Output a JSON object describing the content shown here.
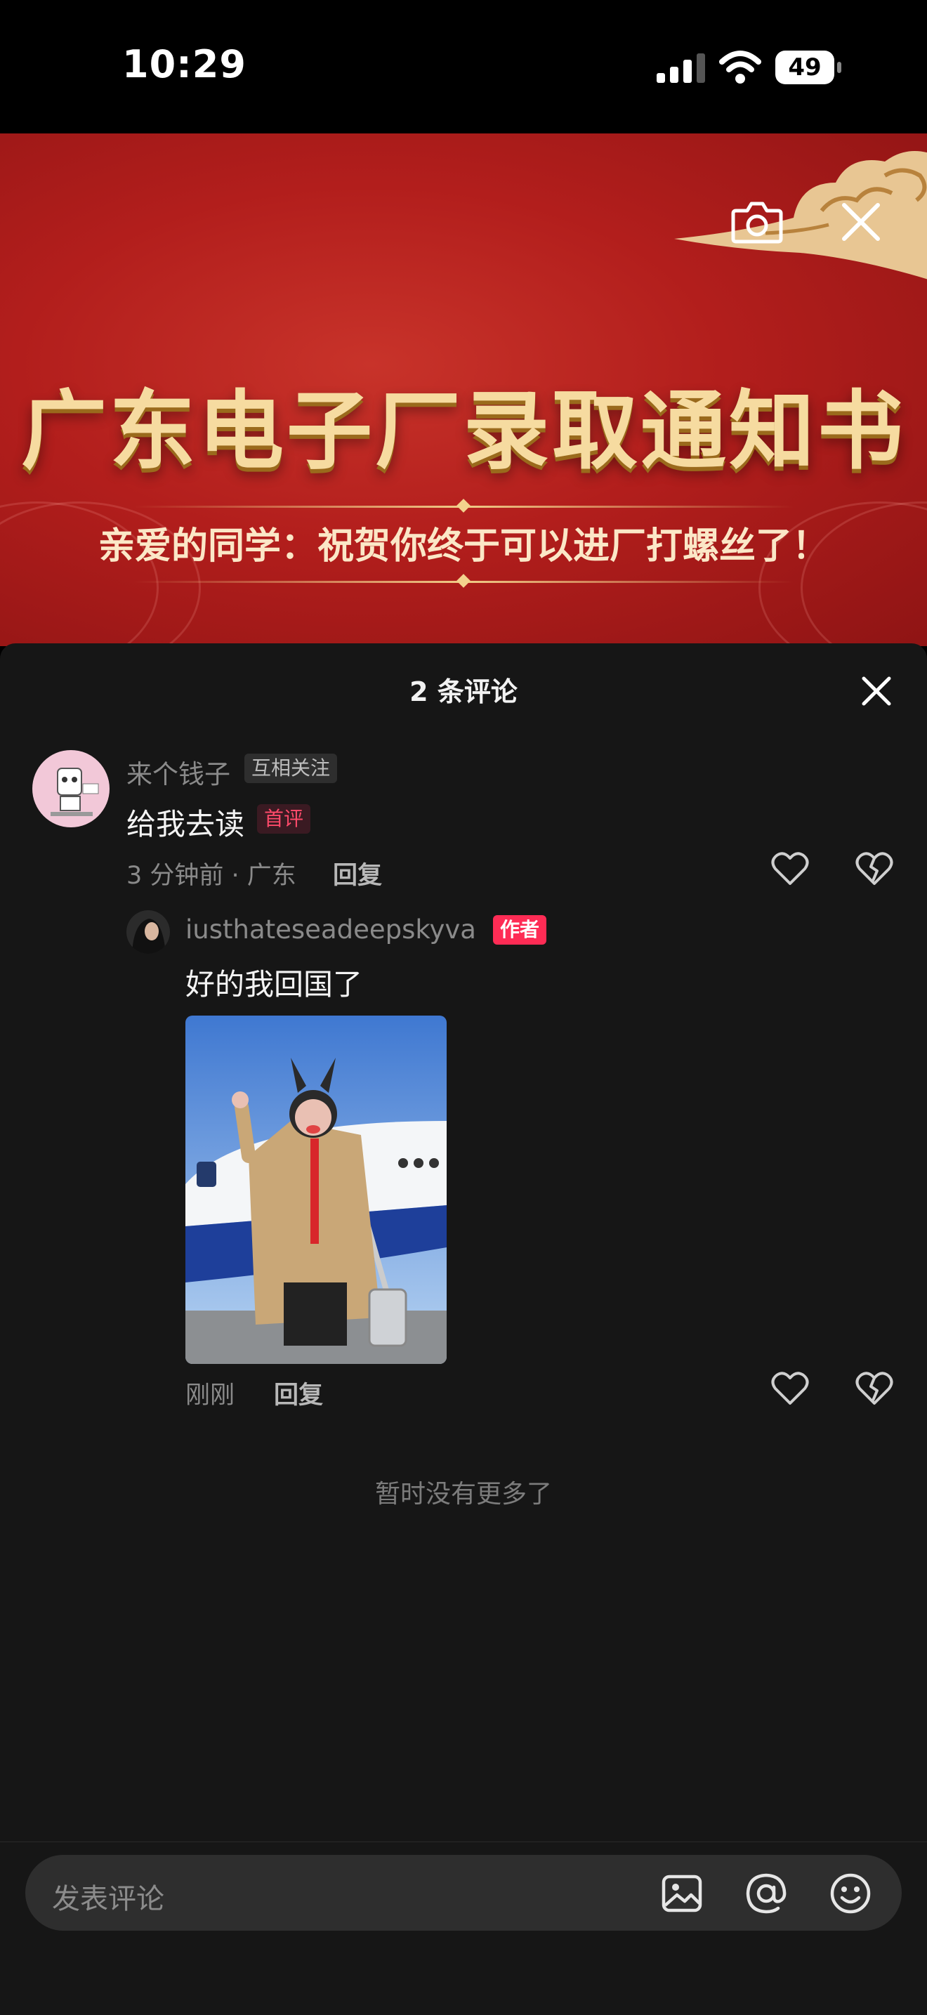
{
  "status_bar": {
    "time": "10:29",
    "battery": "49"
  },
  "banner": {
    "title": "广东电子厂录取通知书",
    "subtitle": "亲爱的同学：祝贺你终于可以进厂打螺丝了！"
  },
  "comments_sheet": {
    "title": "2 条评论",
    "comments": [
      {
        "username": "来个钱子",
        "relation_tag": "互相关注",
        "text": "给我去读",
        "badge": "首评",
        "meta": "3 分钟前 · 广东",
        "reply_label": "回复"
      }
    ],
    "replies": [
      {
        "username": "iusthateseadeepskyva",
        "badge": "作者",
        "text": "好的我回国了",
        "meta": "刚刚",
        "reply_label": "回复"
      }
    ],
    "end_text": "暂时没有更多了"
  },
  "input": {
    "placeholder": "发表评论"
  },
  "colors": {
    "accent": "#fe2c55",
    "sheet_bg": "#161616",
    "input_bg": "#2e2e2e",
    "banner_red": "#b21e1c",
    "banner_gold": "#f6dba0"
  },
  "icons": [
    "signal-icon",
    "wifi-icon",
    "camera-icon",
    "close-icon",
    "heart-icon",
    "broken-heart-icon",
    "image-icon",
    "at-icon",
    "emoji-icon"
  ]
}
